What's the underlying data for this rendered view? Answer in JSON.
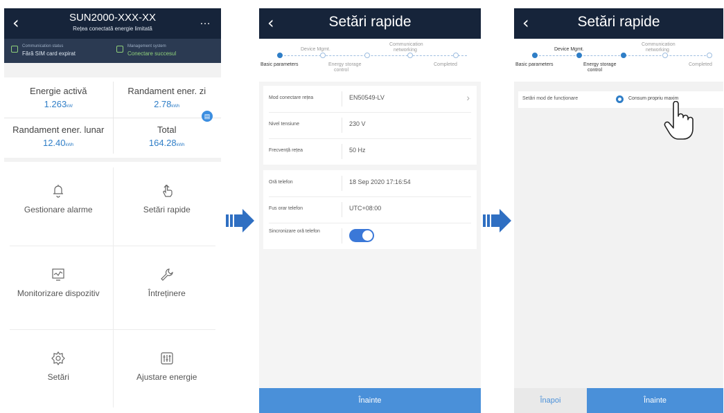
{
  "screen1": {
    "back_icon": "chevron-left-icon",
    "title": "SUN2000-XXX-XX",
    "subtitle": "Rețea conectată energie limitată",
    "more_icon": "more-icon",
    "status": [
      {
        "label": "Communication status",
        "value": "Fără SIM card expirat",
        "icon": "sim-icon"
      },
      {
        "label": "Management system",
        "value": "Conectare succesul",
        "icon": "connection-icon"
      }
    ],
    "energy": [
      {
        "label": "Energie activă",
        "value": "1.263",
        "unit": "kW"
      },
      {
        "label": "Randament ener. zi",
        "value": "2.78",
        "unit": "kWh"
      },
      {
        "label": "Randament ener. lunar",
        "value": "12.40",
        "unit": "kWh"
      },
      {
        "label": "Total",
        "value": "164.28",
        "unit": "kWh"
      }
    ],
    "menu": [
      {
        "label": "Gestionare alarme",
        "icon": "bell-icon"
      },
      {
        "label": "Setări rapide",
        "icon": "touch-icon"
      },
      {
        "label": "Monitorizare dispozitiv",
        "icon": "monitor-icon"
      },
      {
        "label": "Întreținere",
        "icon": "wrench-icon"
      },
      {
        "label": "Setări",
        "icon": "gear-icon"
      },
      {
        "label": "Ajustare energie",
        "icon": "sliders-icon"
      }
    ]
  },
  "screen2": {
    "back_icon": "chevron-left-icon",
    "title": "Setări rapide",
    "steps": {
      "basic": "Basic parameters",
      "device": "Device Mgmt.",
      "storage_line1": "Energy storage",
      "storage_line2": "control",
      "comm_line1": "Communication",
      "comm_line2": "networking",
      "completed": "Completed"
    },
    "rows_group1": [
      {
        "label": "Mod conectare rețea",
        "value": "EN50549-LV"
      },
      {
        "label": "Nivel tensiune",
        "value": "230 V"
      },
      {
        "label": "Frecvență rețea",
        "value": "50 Hz"
      }
    ],
    "rows_group2": [
      {
        "label": "Oră telefon",
        "value": "18 Sep 2020 17:16:54"
      },
      {
        "label": "Fus orar telefon",
        "value": "UTC+08:00"
      },
      {
        "label": "Sincronizare oră telefon"
      }
    ],
    "sync_on": true,
    "next": "Înainte"
  },
  "screen3": {
    "back_icon": "chevron-left-icon",
    "title": "Setări rapide",
    "mode_label": "Setări mod de funcționare",
    "mode_value": "Consum propriu maxim",
    "back": "Înapoi",
    "next": "Înainte"
  },
  "colors": {
    "navbar": "#16243a",
    "accent": "#2f7ec7",
    "button": "#4a90d9",
    "arrow": "#2f6fc2"
  }
}
